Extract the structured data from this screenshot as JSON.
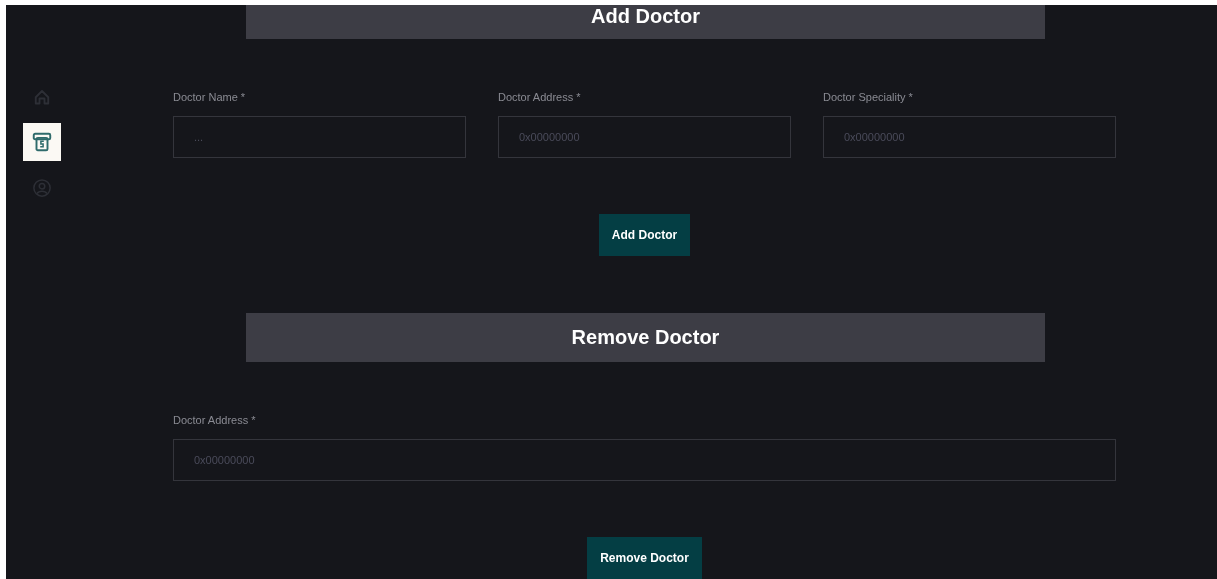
{
  "sidebar": {
    "items": [
      {
        "kind": "home",
        "selected": false
      },
      {
        "kind": "cash",
        "selected": true
      },
      {
        "kind": "user",
        "selected": false
      }
    ]
  },
  "sections": [
    {
      "title": "Add Doctor",
      "fields": [
        {
          "label": "Doctor Name *",
          "placeholder": "..."
        },
        {
          "label": "Doctor Address *",
          "placeholder": "0x00000000"
        },
        {
          "label": "Doctor Speciality *",
          "placeholder": "0x00000000"
        }
      ],
      "button": "Add Doctor"
    },
    {
      "title": "Remove Doctor",
      "fields": [
        {
          "label": "Doctor Address *",
          "placeholder": "0x00000000"
        }
      ],
      "button": "Remove Doctor"
    }
  ]
}
